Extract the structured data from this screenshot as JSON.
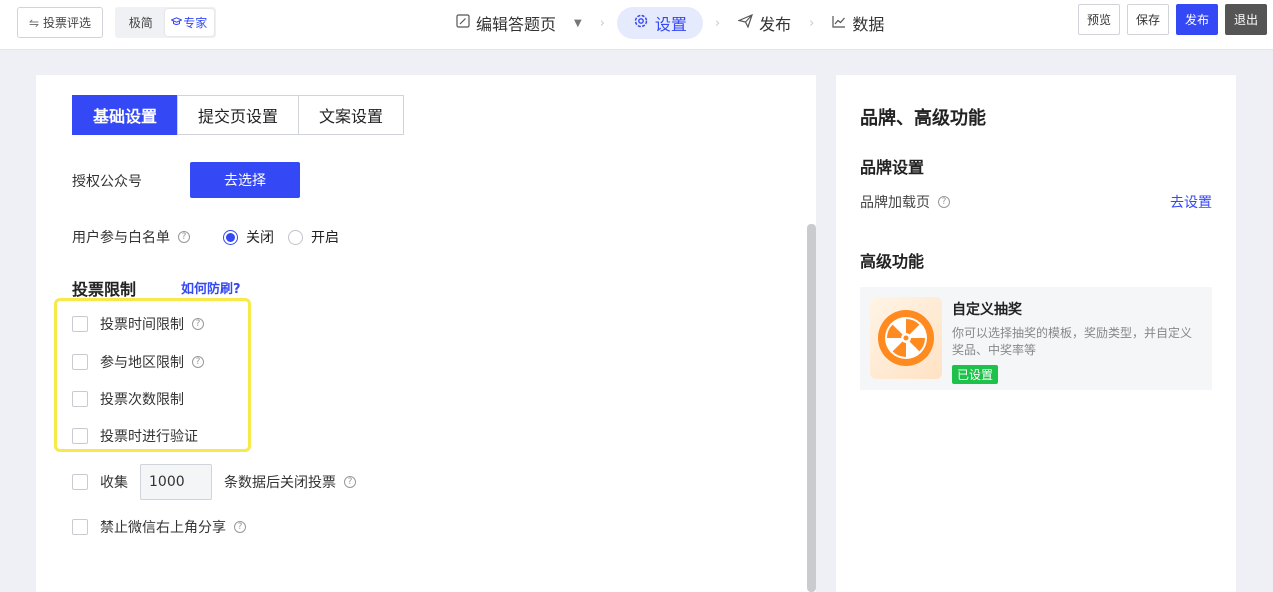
{
  "topbar": {
    "back_label": "投票评选",
    "modes": {
      "simple": "极简",
      "expert": "专家"
    },
    "steps": [
      {
        "label": "编辑答题页"
      },
      {
        "label": "设置"
      },
      {
        "label": "发布"
      },
      {
        "label": "数据"
      }
    ],
    "actions": {
      "preview": "预览",
      "save": "保存",
      "publish": "发布",
      "exit": "退出"
    }
  },
  "main": {
    "tabs": [
      {
        "label": "基础设置",
        "active": true
      },
      {
        "label": "提交页设置",
        "active": false
      },
      {
        "label": "文案设置",
        "active": false
      }
    ],
    "auth": {
      "label": "授权公众号",
      "button": "去选择"
    },
    "whitelist": {
      "label": "用户参与白名单",
      "options": [
        "关闭",
        "开启"
      ],
      "selected": "关闭"
    },
    "vote_limit": {
      "title": "投票限制",
      "link": "如何防刷?",
      "items": [
        {
          "label": "投票时间限制",
          "help": true
        },
        {
          "label": "参与地区限制",
          "help": true
        },
        {
          "label": "投票次数限制",
          "help": false
        },
        {
          "label": "投票时进行验证",
          "help": false
        }
      ]
    },
    "collect": {
      "prefix": "收集",
      "value": "1000",
      "suffix": "条数据后关闭投票"
    },
    "forbid_share": {
      "label": "禁止微信右上角分享"
    }
  },
  "side": {
    "title": "品牌、高级功能",
    "brand_section": "品牌设置",
    "brand_loading": {
      "label": "品牌加载页",
      "link": "去设置"
    },
    "advanced_section": "高级功能",
    "feature": {
      "title": "自定义抽奖",
      "desc": "你可以选择抽奖的模板，奖励类型，并自定义奖品、中奖率等",
      "badge": "已设置"
    }
  },
  "colors": {
    "accent": "#3548f5",
    "highlight": "#f7e94a",
    "success": "#1ec24a"
  }
}
